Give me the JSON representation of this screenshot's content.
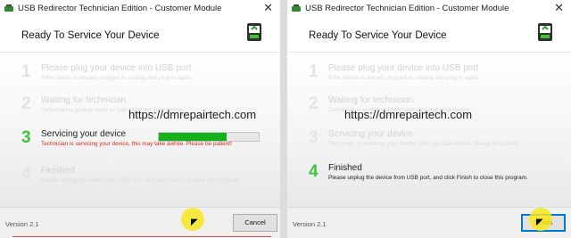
{
  "title": "USB Redirector Technician Edition - Customer Module",
  "close_symbol": "✕",
  "header_title": "Ready To Service Your Device",
  "watermark": "https://dmrepairtech.com",
  "version": "Version 2.1",
  "left": {
    "steps": [
      {
        "num": "1",
        "title": "Please plug your device into USB port",
        "desc": "If the device is already plugged in, unplug and plug in again."
      },
      {
        "num": "2",
        "title": "Waiting for technician",
        "desc": "Technician is getting ready to start servicing your device."
      },
      {
        "num": "3",
        "title": "Servicing your device",
        "desc": "Technician is servicing your device, this may take awhile. Please be patient!"
      },
      {
        "num": "4",
        "title": "Finished",
        "desc": "Please unplug the device from USB port, and click Finish to close this program."
      }
    ],
    "progress_fraction": 0.68,
    "button_label": "Cancel"
  },
  "right": {
    "steps": [
      {
        "num": "1",
        "title": "Please plug your device into USB port",
        "desc": "If the device is already plugged in, unplug and plug in again."
      },
      {
        "num": "2",
        "title": "Waiting for technician",
        "desc": "Technician is getting ready to start servicing your device."
      },
      {
        "num": "3",
        "title": "Servicing your device",
        "desc": "Technician is servicing your device, this may take awhile. Please be patient!"
      },
      {
        "num": "4",
        "title": "Finished",
        "desc": "Please unplug the device from USB port, and click Finish to close this program."
      }
    ],
    "button_label": "Finish"
  },
  "colors": {
    "accent_green": "#3fc33b",
    "progress_green": "#16b01c",
    "error_red": "#d22a1f",
    "button_focus": "#0078d7",
    "highlight": "#f6e81e"
  },
  "icons": {
    "app": "usb-redirector-app-icon",
    "logo": "usb-drive-logo-icon",
    "cursor": "mouse-pointer-icon"
  }
}
